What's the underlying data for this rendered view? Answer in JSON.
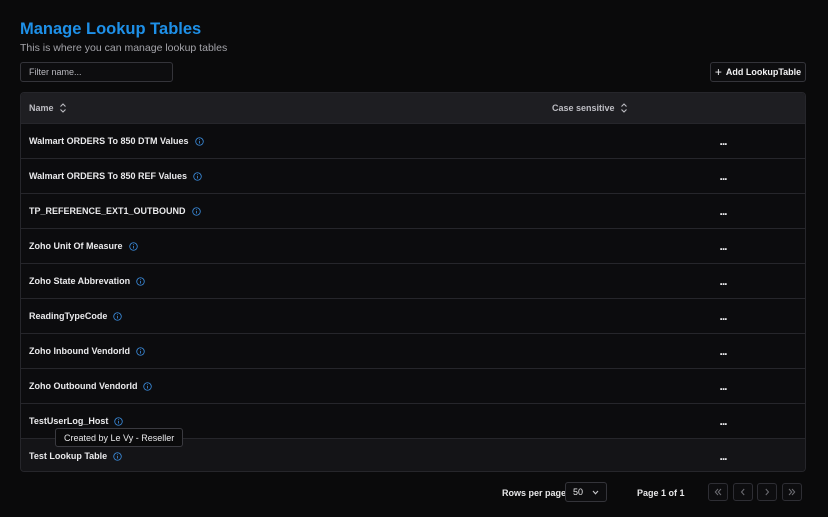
{
  "header": {
    "title": "Manage Lookup Tables",
    "subtitle": "This is where you can manage lookup tables"
  },
  "filter": {
    "placeholder": "Filter name...",
    "value": ""
  },
  "toolbar": {
    "add_label": "Add LookupTable",
    "add_icon": "plus-icon"
  },
  "table": {
    "columns": [
      "Name",
      "Case sensitive"
    ],
    "rows": [
      {
        "name": "Walmart ORDERS To 850 DTM Values"
      },
      {
        "name": "Walmart ORDERS To 850 REF Values"
      },
      {
        "name": "TP_REFERENCE_EXT1_OUTBOUND"
      },
      {
        "name": "Zoho Unit Of Measure"
      },
      {
        "name": "Zoho State Abbrevation"
      },
      {
        "name": "ReadingTypeCode"
      },
      {
        "name": "Zoho Inbound VendorId"
      },
      {
        "name": "Zoho Outbound VendorId"
      },
      {
        "name": "TestUserLog_Host"
      },
      {
        "name": "Test Lookup Table"
      }
    ],
    "row_action": "...",
    "info_icon": "info-icon"
  },
  "tooltip": {
    "text": "Created by Le Vy - Reseller"
  },
  "pagination": {
    "rows_per_page_label": "Rows per page",
    "rows_per_page_value": "50",
    "page_info": "Page 1 of 1"
  },
  "colors": {
    "accent": "#1e90e8",
    "background": "#0a0a0b",
    "header_row": "#1e1e22"
  }
}
